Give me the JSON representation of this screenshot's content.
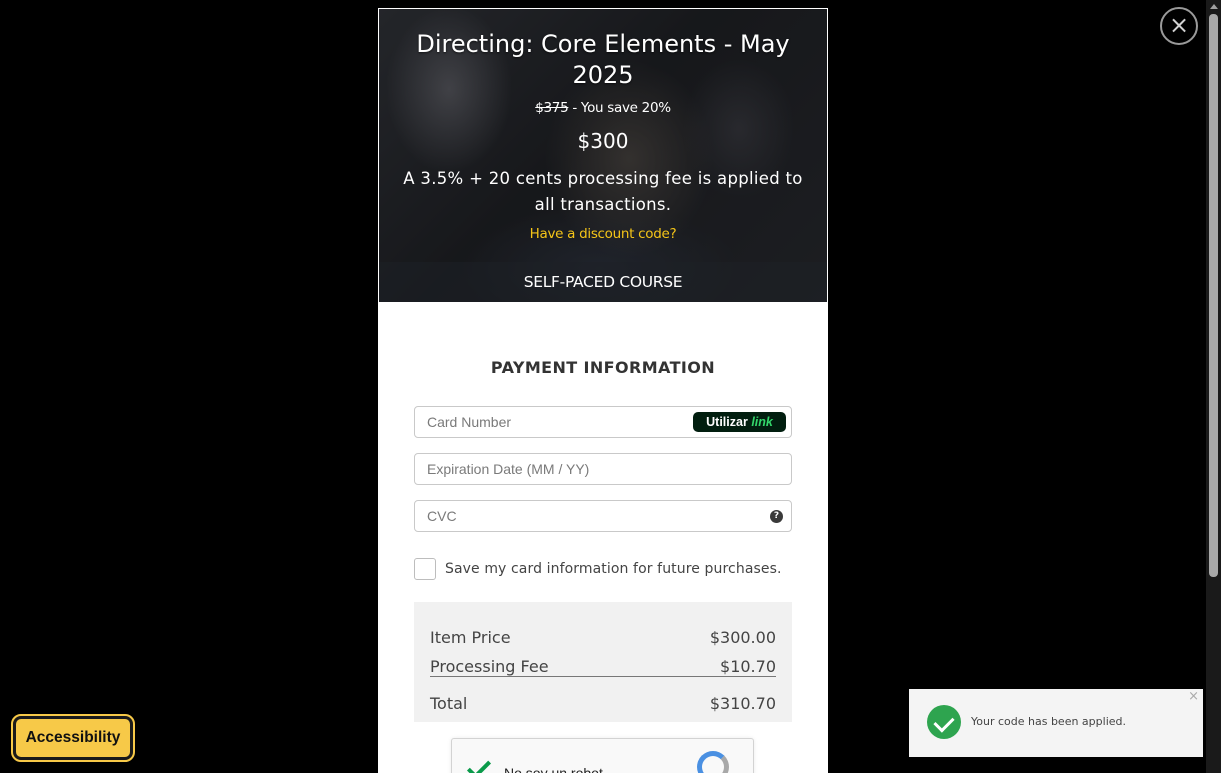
{
  "course": {
    "title": "Directing: Core Elements - May 2025",
    "original_price": "$375",
    "savings_text": " - You save 20%",
    "current_price": "$300",
    "fee_note": "A 3.5% + 20 cents processing fee is applied to all transactions.",
    "discount_link": "Have a discount code?",
    "course_type": "SELF-PACED COURSE"
  },
  "payment": {
    "title": "PAYMENT INFORMATION",
    "card_number_placeholder": "Card Number",
    "link_badge_prefix": "Utilizar",
    "link_badge_brand": "link",
    "expiration_placeholder": "Expiration Date (MM / YY)",
    "cvc_placeholder": "CVC",
    "cvc_help": "?",
    "save_card_label": "Save my card information for future purchases.",
    "save_card_checked": false
  },
  "summary": {
    "rows": [
      {
        "label": "Item Price",
        "value": "$300.00"
      },
      {
        "label": "Processing Fee",
        "value": "$10.70"
      }
    ],
    "total_label": "Total",
    "total_value": "$310.70"
  },
  "recaptcha": {
    "label": "No soy un robot"
  },
  "toast": {
    "message": "Your code has been applied.",
    "close": "×"
  },
  "close_button": "×",
  "accessibility_label": "Accessibility",
  "colors": {
    "discount_link": "#f5c518",
    "accessibility_bg": "#f7c948",
    "toast_success": "#2ea44f",
    "link_badge_bg": "#011e0f",
    "link_badge_brand": "#33d66a"
  }
}
